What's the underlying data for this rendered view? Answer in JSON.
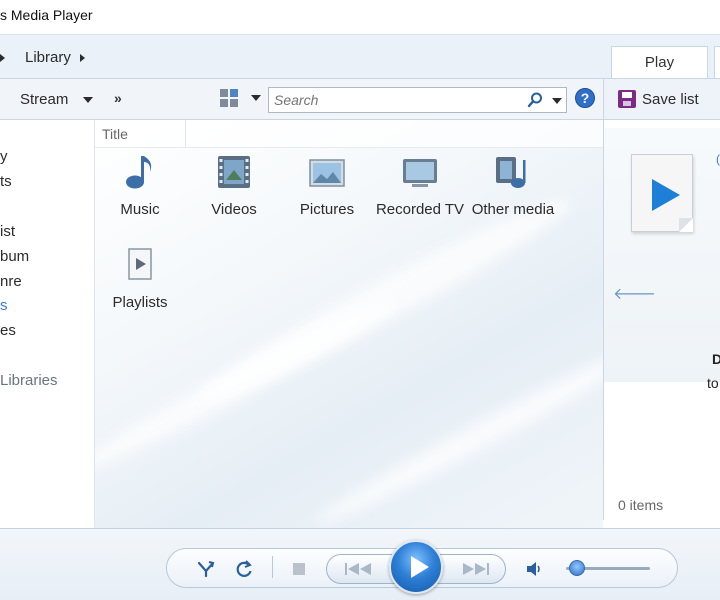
{
  "window": {
    "title": "s Media Player"
  },
  "nav": {
    "breadcrumb_library": "Library",
    "play_tab": "Play"
  },
  "toolbar": {
    "stream_label": "Stream",
    "overflow_label": "»",
    "search_placeholder": "Search",
    "help_label": "?",
    "save_list_label": "Save list"
  },
  "sidebar": {
    "items": [
      {
        "label": "y"
      },
      {
        "label": "ts"
      },
      {
        "label": "ist"
      },
      {
        "label": "bum"
      },
      {
        "label": "nre"
      },
      {
        "label": "s",
        "selected": true
      },
      {
        "label": "es"
      },
      {
        "label": "Libraries"
      }
    ]
  },
  "content": {
    "column_header": "Title",
    "tiles": [
      {
        "label": "Music",
        "icon": "music-note-icon"
      },
      {
        "label": "Videos",
        "icon": "film-strip-icon"
      },
      {
        "label": "Pictures",
        "icon": "landscape-picture-icon"
      },
      {
        "label": "Recorded TV",
        "icon": "monitor-icon"
      },
      {
        "label": "Other media",
        "icon": "other-media-icon"
      },
      {
        "label": "Playlists",
        "icon": "playlist-icon"
      }
    ]
  },
  "list_pane": {
    "drag_text_1": "D",
    "drag_text_2": "to",
    "items_count": "0 items"
  },
  "playback": {
    "volume_level": 0.1
  },
  "colors": {
    "accent": "#2e7fd6",
    "selected_nav": "#3a7bd5"
  }
}
